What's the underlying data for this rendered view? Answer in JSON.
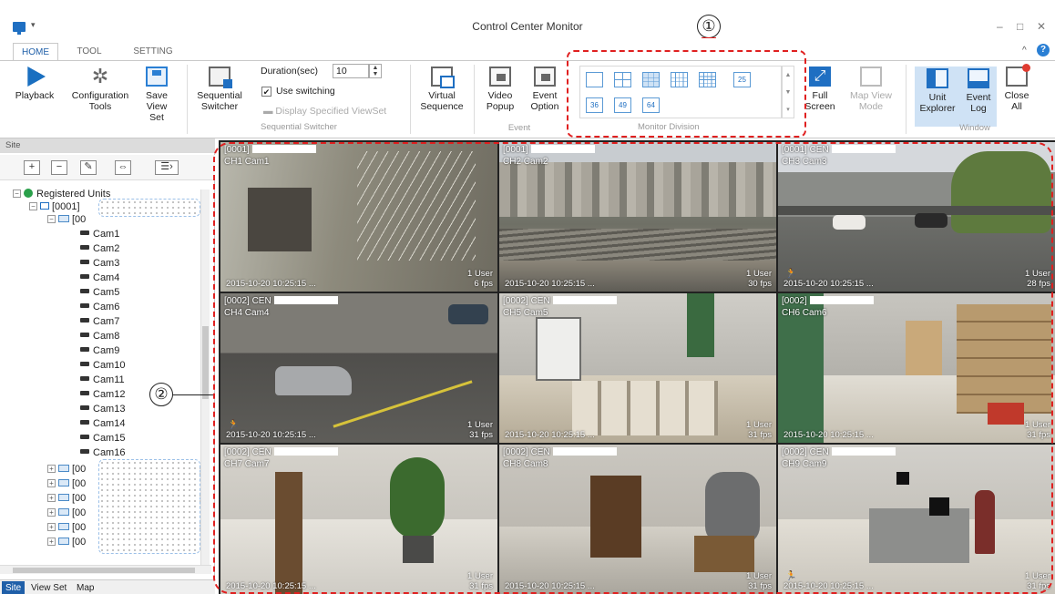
{
  "window": {
    "title": "Control Center Monitor",
    "minimize": "–",
    "maximize": "□",
    "close": "✕",
    "qa_menu": "▾"
  },
  "ribbon_tabs": [
    "HOME",
    "TOOL",
    "SETTING"
  ],
  "ribbon_controls": {
    "collapse": "^",
    "help": "?"
  },
  "ribbon": {
    "playback": "Playback",
    "config_tools": "Configuration Tools",
    "save_view_set": "Save View Set",
    "sequential_switcher": "Sequential Switcher",
    "duration_label": "Duration(sec)",
    "duration_value": "10",
    "use_switching": "Use switching",
    "display_viewset": "Display Specified ViewSet",
    "group_seq": "Sequential Switcher",
    "virtual_sequence": "Virtual Sequence",
    "video_popup": "Video Popup",
    "event_option": "Event Option",
    "group_event": "Event",
    "div_numbers": [
      "25",
      "36",
      "49",
      "64"
    ],
    "group_monitor": "Monitor Division",
    "full_screen": "Full Screen",
    "map_view_mode": "Map View Mode",
    "unit_explorer": "Unit Explorer",
    "event_log": "Event Log",
    "close_all": "Close All",
    "group_window": "Window"
  },
  "annotations": {
    "one": "①",
    "two": "②"
  },
  "site_panel": {
    "header": "Site",
    "root": "Registered Units",
    "unit": "[0001]",
    "group": "[00",
    "cams": [
      "Cam1",
      "Cam2",
      "Cam3",
      "Cam4",
      "Cam5",
      "Cam6",
      "Cam7",
      "Cam8",
      "Cam9",
      "Cam10",
      "Cam11",
      "Cam12",
      "Cam13",
      "Cam14",
      "Cam15",
      "Cam16"
    ],
    "other_groups": [
      "[00",
      "[00",
      "[00",
      "[00",
      "[00",
      "[00"
    ],
    "bottom_tabs": [
      "Site",
      "View Set",
      "Map"
    ]
  },
  "cameras": [
    {
      "id": "[0001]",
      "ch": "CH1 Cam1",
      "ts": "2015-10-20 10:25:15 ...",
      "users": "1 User",
      "fps": "6 fps"
    },
    {
      "id": "[0001]",
      "ch": "CH2 Cam2",
      "ts": "2015-10-20 10:25:15 ...",
      "users": "1 User",
      "fps": "30 fps"
    },
    {
      "id": "[0001] CEN",
      "ch": "CH3 Cam3",
      "ts": "2015-10-20 10:25:15 ...",
      "users": "1 User",
      "fps": "28 fps"
    },
    {
      "id": "[0002] CEN",
      "ch": "CH4 Cam4",
      "ts": "2015-10-20 10:25:15 ...",
      "users": "1 User",
      "fps": "31 fps"
    },
    {
      "id": "[0002] CEN",
      "ch": "CH5 Cam5",
      "ts": "2015-10-20 10:25:15 ...",
      "users": "1 User",
      "fps": "31 fps"
    },
    {
      "id": "[0002]",
      "ch": "CH6 Cam6",
      "ts": "2015-10-20 10:25:15 ...",
      "users": "1 User",
      "fps": "31 fps"
    },
    {
      "id": "[0002] CEN",
      "ch": "CH7 Cam7",
      "ts": "2015-10-20 10:25:15 ...",
      "users": "1 User",
      "fps": "31 fps"
    },
    {
      "id": "[0002] CEN",
      "ch": "CH8 Cam8",
      "ts": "2015-10-20 10:25:15 ...",
      "users": "1 User",
      "fps": "31 fps"
    },
    {
      "id": "[0002] CEN",
      "ch": "CH9 Cam9",
      "ts": "2015-10-20 10:25:15 ...",
      "users": "1 User",
      "fps": "31 fps"
    }
  ]
}
